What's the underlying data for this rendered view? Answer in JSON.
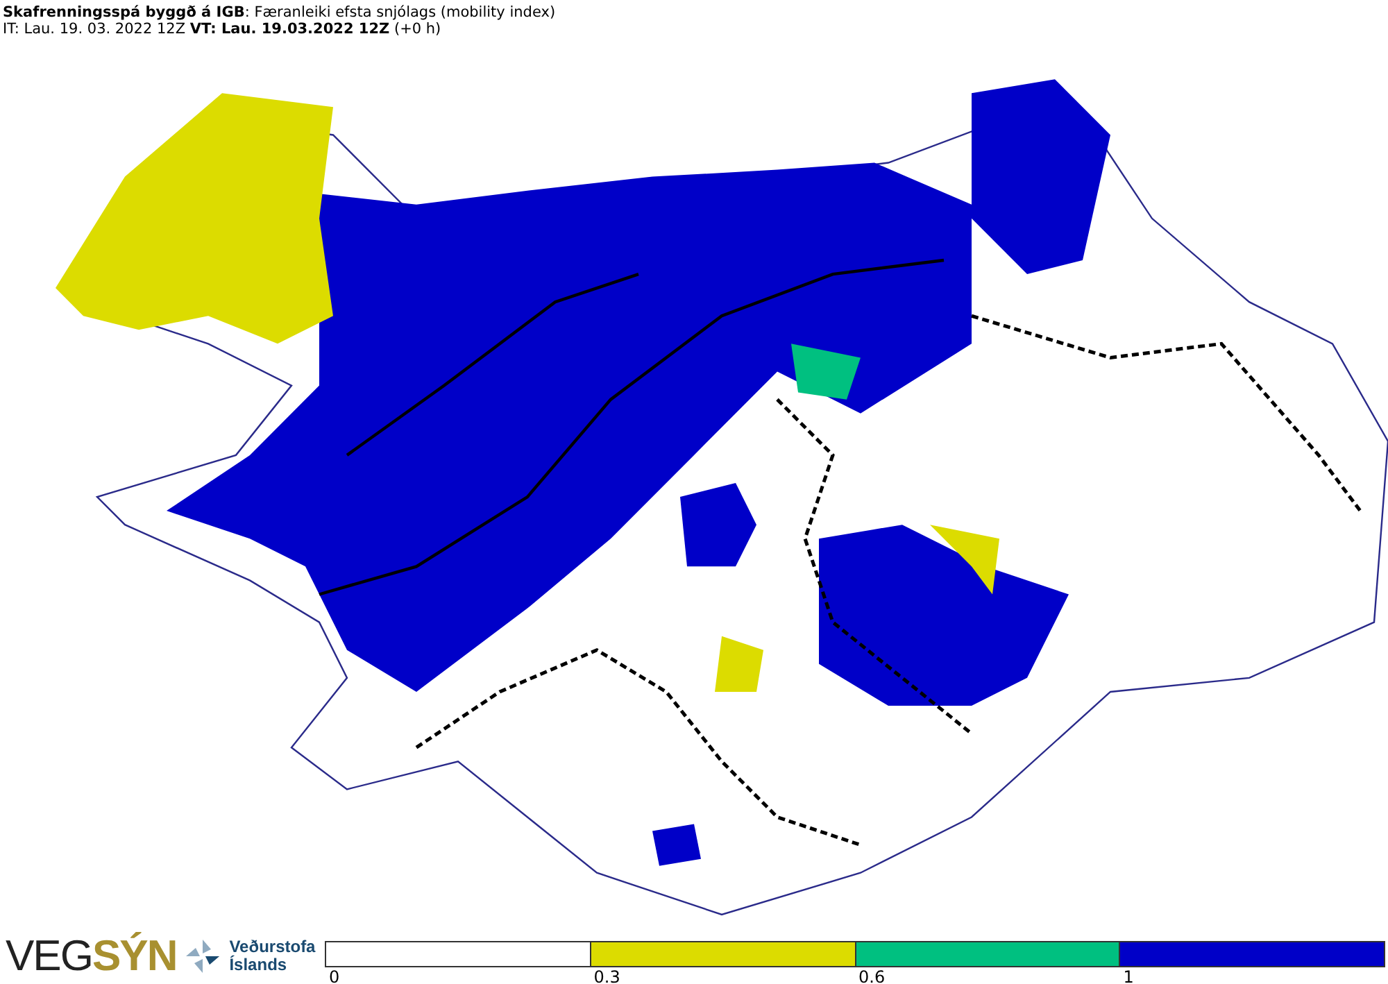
{
  "header": {
    "title": "**Skafrenningsspá byggð á IGB**: Færanleiki efsta snjólags (mobility index)",
    "times": "IT: Lau. 19. 03. 2022 12Z **VT: Lau. 19.03.2022 12Z** (+0 h)"
  },
  "logos": {
    "vegsyn": [
      "VEG",
      "SÝN"
    ],
    "vedur": [
      "Veðurstofa",
      "Íslands"
    ]
  },
  "legend": {
    "bins": [
      {
        "color": "#ffffff",
        "label": "0"
      },
      {
        "color": "#dcdc00",
        "label": "0.3"
      },
      {
        "color": "#00c080",
        "label": "0.6"
      },
      {
        "color": "#0000c8",
        "label": "1"
      }
    ]
  }
}
